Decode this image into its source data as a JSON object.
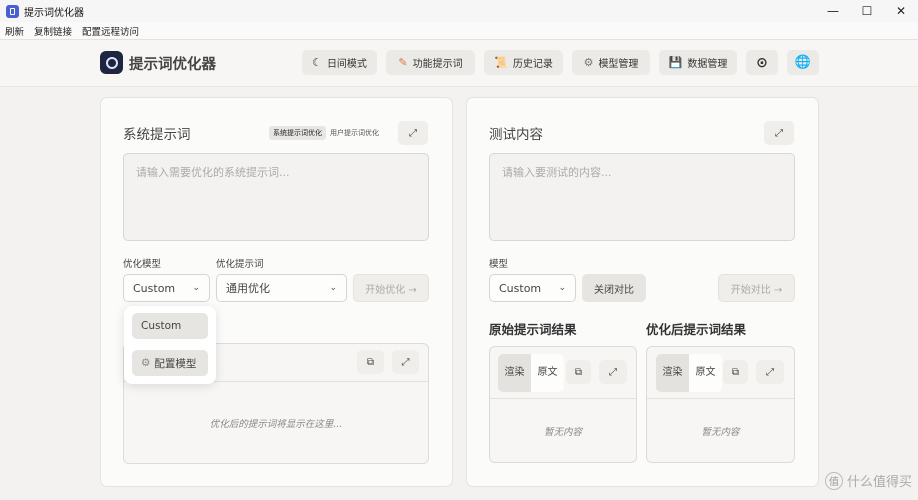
{
  "window": {
    "title": "提示词优化器",
    "controls": {
      "minimize": "—",
      "maximize": "☐",
      "close": "✕"
    }
  },
  "menu": [
    "刷新",
    "复制链接",
    "配置远程访问"
  ],
  "header": {
    "brand": "提示词优化器",
    "nav": [
      {
        "label": "日间模式",
        "icon": "moon-icon",
        "glyph": "☾"
      },
      {
        "label": "功能提示词",
        "icon": "edit-document-icon",
        "glyph": "✎"
      },
      {
        "label": "历史记录",
        "icon": "scroll-icon",
        "glyph": "📜"
      },
      {
        "label": "模型管理",
        "icon": "gear-icon",
        "glyph": "⚙"
      },
      {
        "label": "数据管理",
        "icon": "save-icon",
        "glyph": "💾"
      }
    ],
    "github_glyph": "⊙",
    "language_glyph": "🌐"
  },
  "left": {
    "title": "系统提示词",
    "tabs": {
      "system": "系统提示词优化",
      "user": "用户提示词优化"
    },
    "expand_glyph": "⤢",
    "placeholder": "请输入需要优化的系统提示词...",
    "model_label": "优化模型",
    "model_value": "Custom",
    "template_label": "优化提示词",
    "template_value": "通用优化",
    "start_button": "开始优化 →",
    "dropdown": {
      "option": "Custom",
      "configure": "配置模型",
      "configure_glyph": "⚙"
    },
    "output_placeholder": "优化后的提示词将显示在这里...",
    "copy_glyph": "⧉",
    "chevron": "⌄"
  },
  "right": {
    "title": "测试内容",
    "expand_glyph": "⤢",
    "placeholder": "请输入要测试的内容...",
    "model_label": "模型",
    "model_value": "Custom",
    "compare_button": "关闭对比",
    "start_button": "开始对比 →",
    "original_title": "原始提示词结果",
    "optimized_title": "优化后提示词结果",
    "render_label": "渲染",
    "raw_label": "原文",
    "empty": "暂无内容"
  },
  "watermark": {
    "text": "什么值得买",
    "glyph": "值"
  }
}
